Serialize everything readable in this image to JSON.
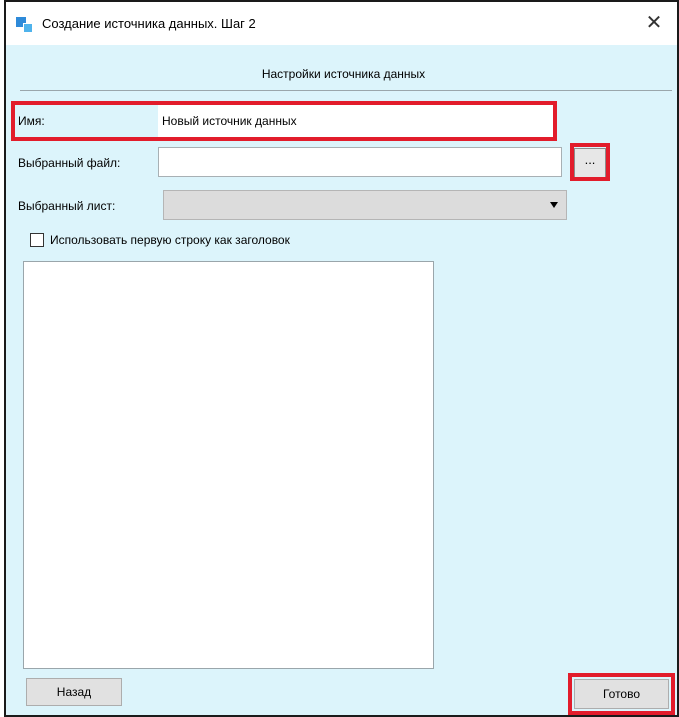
{
  "window": {
    "title": "Создание источника данных. Шаг 2",
    "close_glyph": "✕"
  },
  "section": {
    "title": "Настройки источника данных"
  },
  "form": {
    "name_label": "Имя:",
    "name_value": "Новый источник данных",
    "file_label": "Выбранный файл:",
    "file_value": "",
    "browse_label": "...",
    "sheet_label": "Выбранный лист:",
    "sheet_value": "",
    "header_checkbox_label": "Использовать первую строку как заголовок",
    "header_checkbox_checked": false
  },
  "buttons": {
    "back_label": "Назад",
    "done_label": "Готово"
  },
  "colors": {
    "highlight": "#e21c2b",
    "dialog_bg": "#dcf4fb"
  },
  "icons": {
    "app": "app-window-icon",
    "close": "close-icon",
    "dropdown": "chevron-down-icon"
  }
}
